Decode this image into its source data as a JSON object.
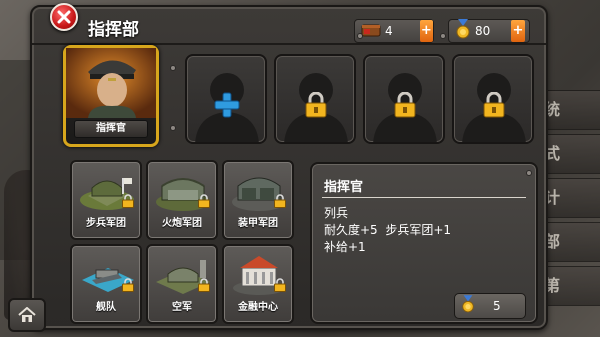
{
  "window": {
    "title": "指挥部"
  },
  "resources": {
    "supply": {
      "amount": "4",
      "icon": "supply-crate-icon"
    },
    "medals": {
      "amount": "80",
      "icon": "medal-icon"
    },
    "plus_label": "+"
  },
  "commander": {
    "label": "指挥官",
    "icon": "general-portrait"
  },
  "slots": [
    {
      "state": "add",
      "icon": "plus-icon"
    },
    {
      "state": "locked",
      "icon": "lock-icon"
    },
    {
      "state": "locked",
      "icon": "lock-icon"
    },
    {
      "state": "locked",
      "icon": "lock-icon"
    }
  ],
  "buildings": [
    {
      "label": "步兵军团",
      "icon": "infantry-barracks-icon"
    },
    {
      "label": "火炮军团",
      "icon": "artillery-hangar-icon"
    },
    {
      "label": "装甲军团",
      "icon": "armor-hangar-icon"
    },
    {
      "label": "舰队",
      "icon": "fleet-dock-icon"
    },
    {
      "label": "空军",
      "icon": "airfield-icon"
    },
    {
      "label": "金融中心",
      "icon": "finance-center-icon"
    }
  ],
  "info": {
    "title": "指挥官",
    "rank": "列兵",
    "stats": "耐久度+5  步兵军团+1",
    "supply": "补给+1",
    "cost": "5"
  },
  "side_buttons": [
    "统",
    "式",
    "计",
    "部",
    "第"
  ],
  "colors": {
    "accent": "#d7a61c",
    "plus": "#e87717",
    "close": "#c81818",
    "add": "#2f9be0"
  }
}
